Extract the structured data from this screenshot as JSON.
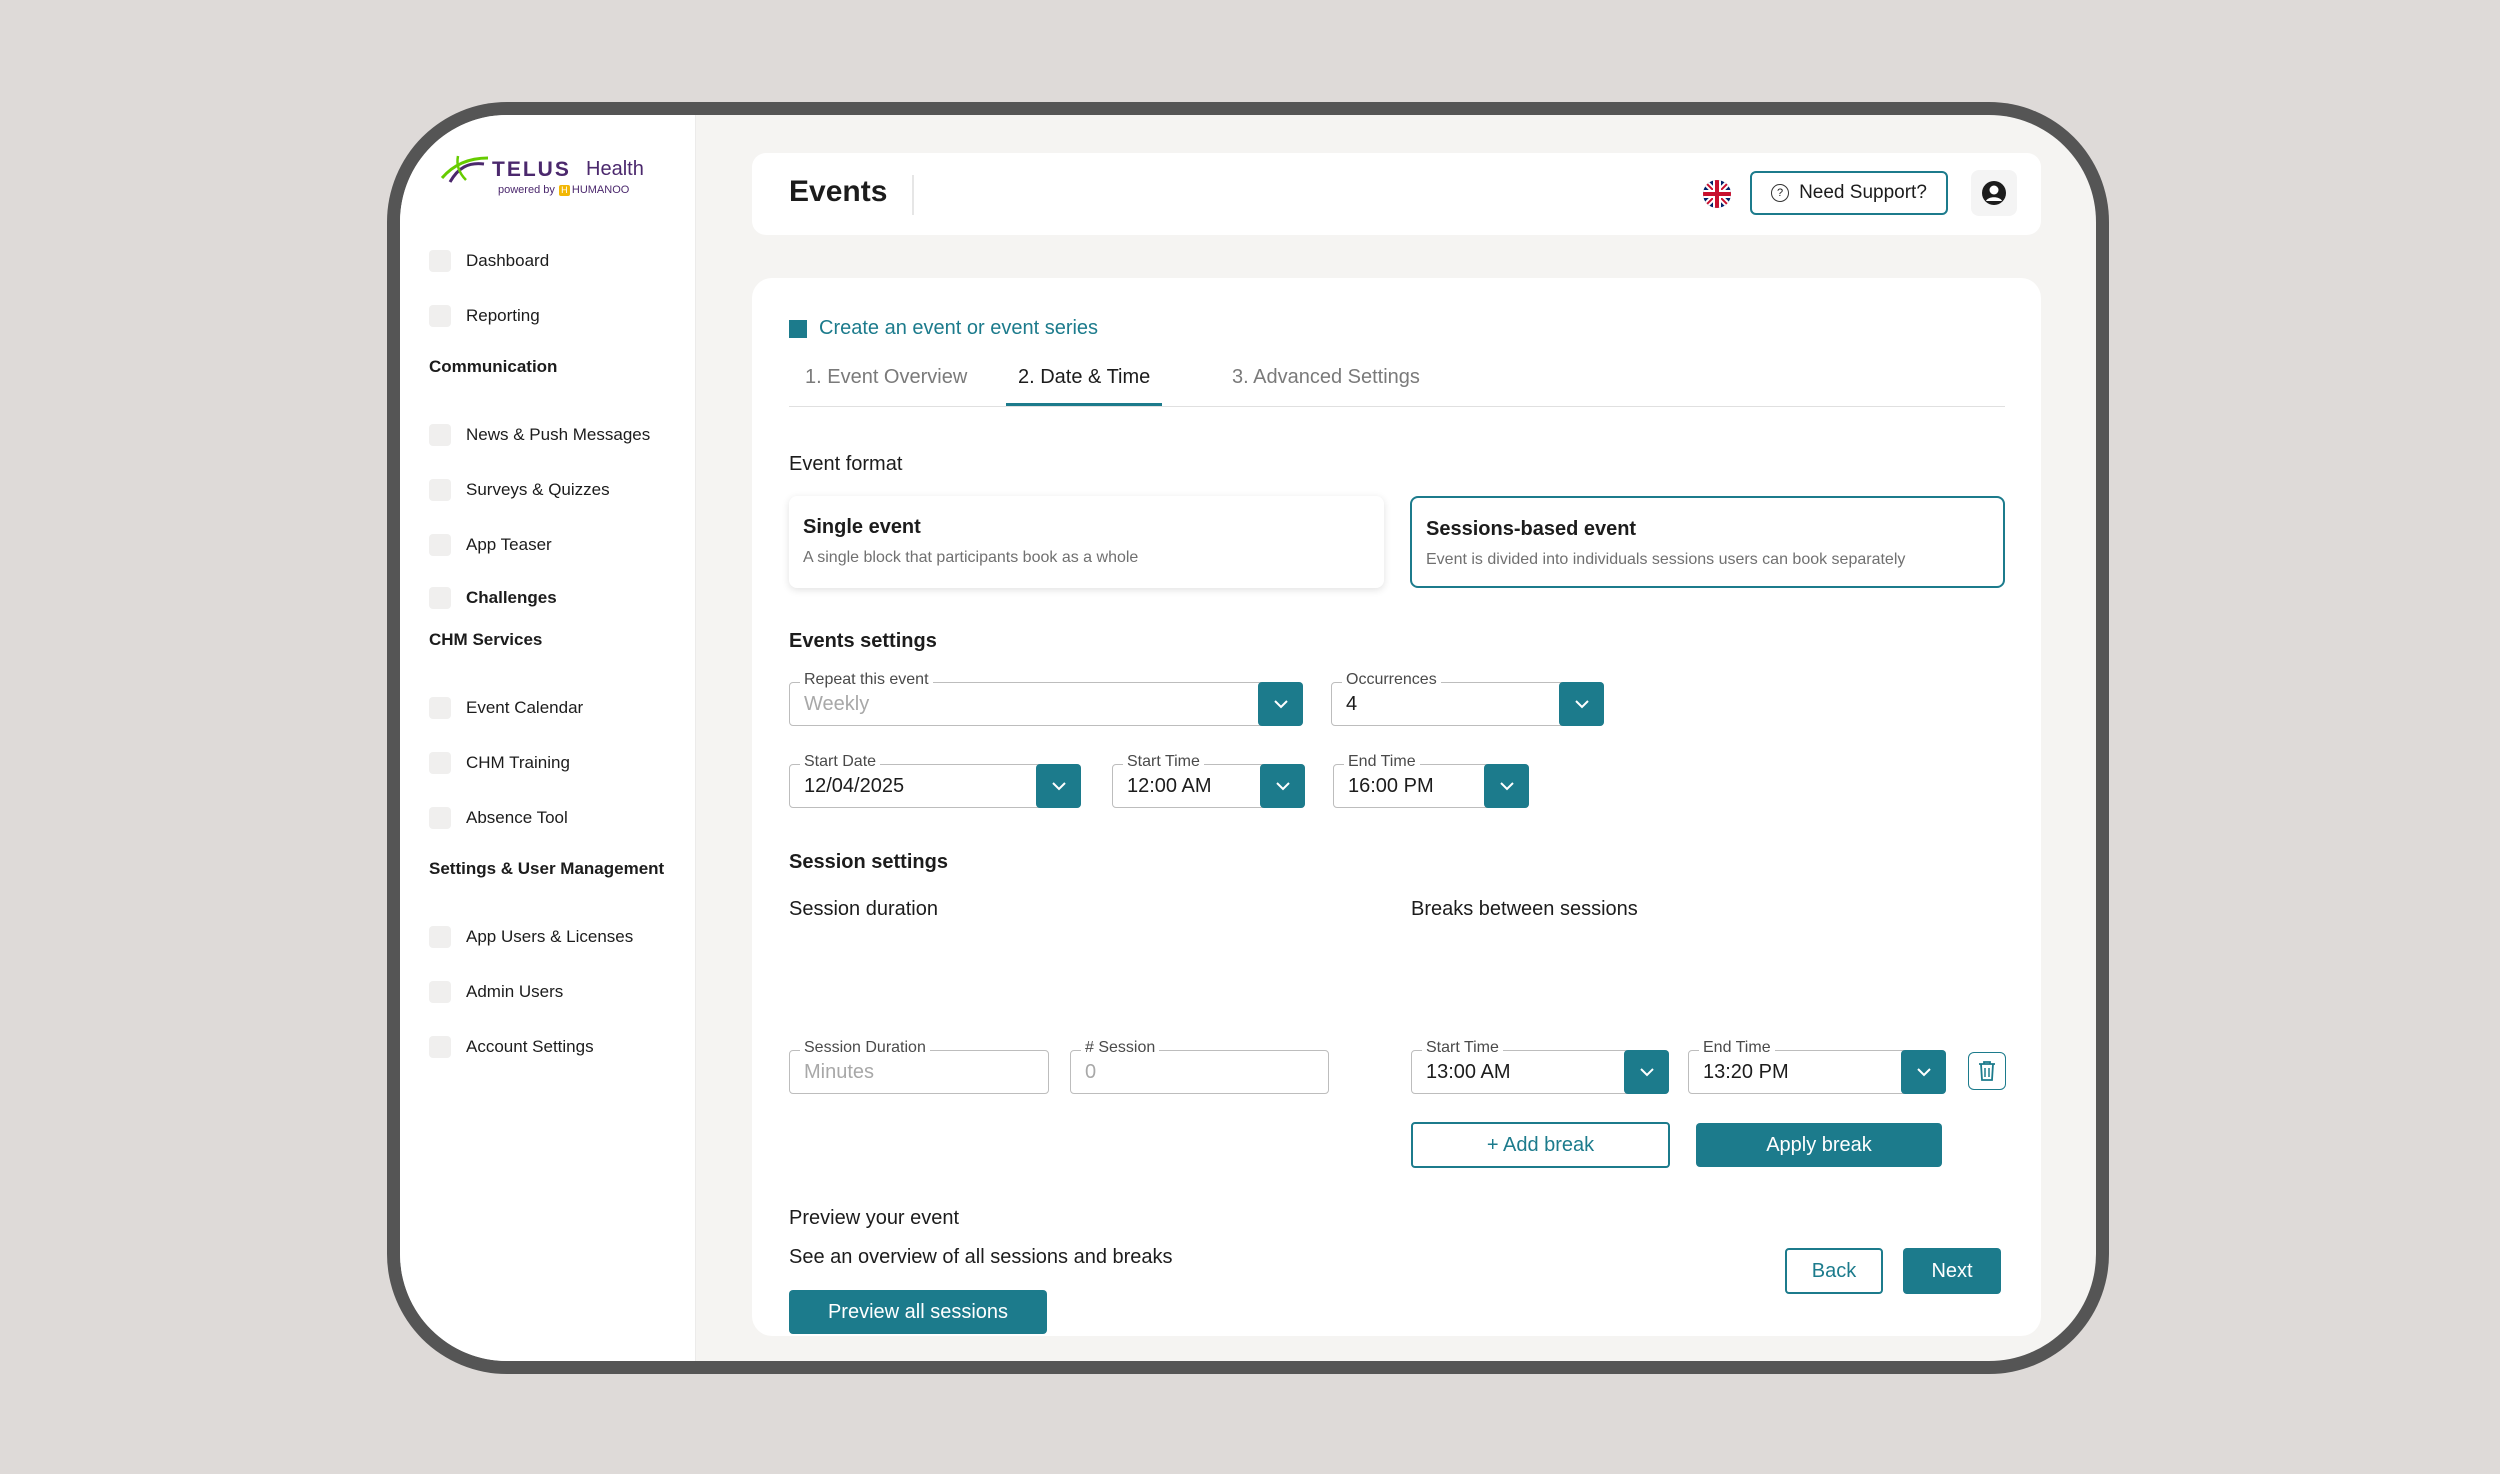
{
  "brand": {
    "telus": "TELUS",
    "health": "Health",
    "powered_by": "powered by",
    "humanoo": "HUMANOO"
  },
  "sidebar": {
    "items_top": [
      {
        "label": "Dashboard"
      },
      {
        "label": "Reporting"
      }
    ],
    "communication": {
      "header": "Communication",
      "items": [
        {
          "label": "News & Push Messages"
        },
        {
          "label": "Surveys & Quizzes"
        },
        {
          "label": "App Teaser"
        },
        {
          "label": "Challenges"
        }
      ]
    },
    "chm": {
      "header": "CHM Services",
      "items": [
        {
          "label": "Event Calendar"
        },
        {
          "label": "CHM Training"
        },
        {
          "label": "Absence Tool"
        }
      ]
    },
    "settings": {
      "header": "Settings & User Management",
      "items": [
        {
          "label": "App Users & Licenses"
        },
        {
          "label": "Admin Users"
        },
        {
          "label": "Account Settings"
        }
      ]
    }
  },
  "header": {
    "title": "Events",
    "support_label": "Need Support?"
  },
  "wizard": {
    "breadcrumb": "Create an event or event series",
    "tabs": [
      {
        "label": "1. Event Overview"
      },
      {
        "label": "2. Date & Time"
      },
      {
        "label": "3. Advanced Settings"
      }
    ],
    "active_tab": 1
  },
  "event_format": {
    "label": "Event format",
    "single": {
      "title": "Single event",
      "desc": "A single block that participants book as a whole"
    },
    "sessions": {
      "title": "Sessions-based event",
      "desc": "Event is divided into individuals sessions users can book separately"
    }
  },
  "events_settings": {
    "header": "Events settings",
    "repeat": {
      "label": "Repeat this event",
      "value": "Weekly"
    },
    "occurrences": {
      "label": "Occurrences",
      "value": "4"
    },
    "start_date": {
      "label": "Start Date",
      "value": "12/04/2025"
    },
    "start_time": {
      "label": "Start Time",
      "value": "12:00 AM"
    },
    "end_time": {
      "label": "End Time",
      "value": "16:00 PM"
    }
  },
  "session_settings": {
    "header": "Session settings",
    "duration_label": "Session duration",
    "duration": {
      "label": "Session Duration",
      "placeholder": "Minutes"
    },
    "count": {
      "label": "# Session",
      "placeholder": "0"
    },
    "breaks_label": "Breaks between sessions",
    "break_start": {
      "label": "Start Time",
      "value": "13:00 AM"
    },
    "break_end": {
      "label": "End Time",
      "value": "13:20 PM"
    },
    "add_break": "+ Add break",
    "apply_break": "Apply break"
  },
  "preview": {
    "label": "Preview your event",
    "desc": "See an overview of all sessions and breaks",
    "button": "Preview all sessions"
  },
  "footer": {
    "back": "Back",
    "next": "Next"
  },
  "colors": {
    "accent": "#1c7b8c",
    "brand_purple": "#4b286d",
    "brand_green": "#66cc00"
  }
}
